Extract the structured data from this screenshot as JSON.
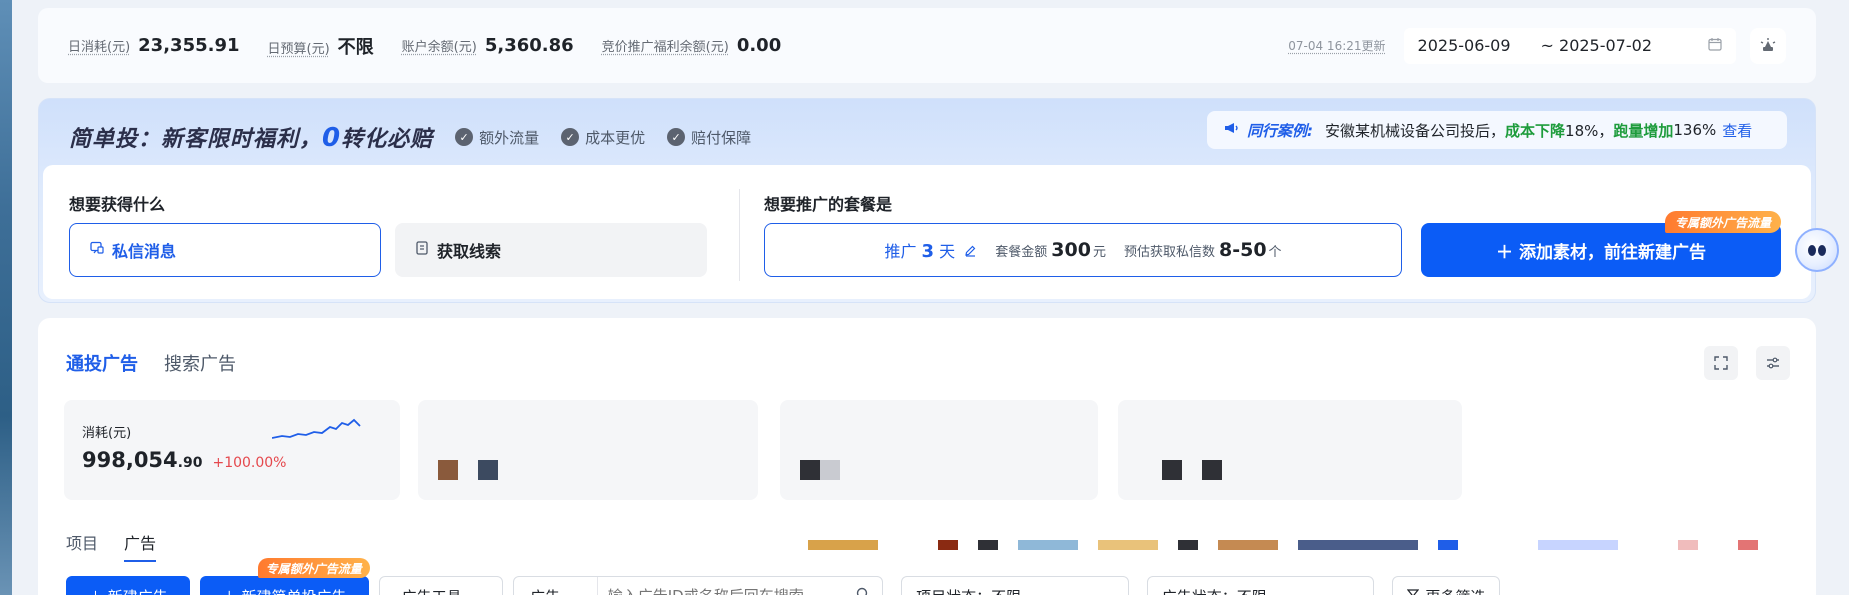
{
  "stats": [
    {
      "label": "日消耗(元)",
      "value": "23,355.91"
    },
    {
      "label": "日预算(元)",
      "value": "不限"
    },
    {
      "label": "账户余额(元)",
      "value": "5,360.86"
    },
    {
      "label": "竞价推广福利余额(元)",
      "value": "0.00"
    }
  ],
  "updated": "07-04 16:21更新",
  "date_range": {
    "start": "2025-06-09",
    "end": "~ 2025-07-02"
  },
  "icons": {
    "calendar": "calendar-icon",
    "theme": "bulb-icon",
    "megaphone": "megaphone-icon",
    "check": "check-circle-icon",
    "chat": "chat-icon",
    "form": "form-icon",
    "edit": "edit-icon",
    "expand": "expand-icon",
    "settings": "settings-icon",
    "search": "search-icon",
    "filter": "filter-icon"
  },
  "promo": {
    "title_a": "简单投：新客限时福利，",
    "title_zero": "0",
    "title_b": "转化必赔",
    "perks": [
      "额外流量",
      "成本更优",
      "赔付保障"
    ],
    "case_label": "同行案例:",
    "case_text": "安徽某机械设备公司投后，",
    "case_hl1": "成本下降",
    "case_v1": "18%，",
    "case_hl2": "跑量增加",
    "case_v2": "136%",
    "case_link": "查看",
    "goal_label": "想要获得什么",
    "goal_active": "私信消息",
    "goal_inactive": "获取线索",
    "package_label": "想要推广的套餐是",
    "pkg_days_prefix": "推广",
    "pkg_days": "3",
    "pkg_days_unit": "天",
    "pkg_amount_label": "套餐金额",
    "pkg_amount": "300",
    "pkg_amount_unit": "元",
    "pkg_expect_label": "预估获取私信数",
    "pkg_expect": "8-50",
    "pkg_expect_unit": "个",
    "add_button": "＋ 添加素材，前往新建广告",
    "add_badge": "专属额外广告流量"
  },
  "main": {
    "tabs": [
      "通投广告",
      "搜索广告"
    ],
    "metric": {
      "label": "消耗(元)",
      "value_int": "998,054",
      "value_dec": ".90",
      "change": "+100.00%"
    },
    "sub_tabs": [
      "项目",
      "广告"
    ],
    "toolbar": {
      "new_ad": "＋ 新建广告",
      "new_simple": "＋ 新建简单投广告",
      "simple_badge": "专属额外广告流量",
      "ad_tools": "广告工具",
      "search_type": "广告",
      "search_placeholder": "输入广告ID或名称后回车搜索",
      "project_status": "项目状态：不限",
      "ad_status": "广告状态：不限",
      "more_filter": "更多筛选"
    }
  },
  "colors": {
    "accent": "#1f5ee8",
    "primary_btn": "#0b5cf6",
    "positive": "#1e9c3c",
    "negative": "#e5484d"
  }
}
